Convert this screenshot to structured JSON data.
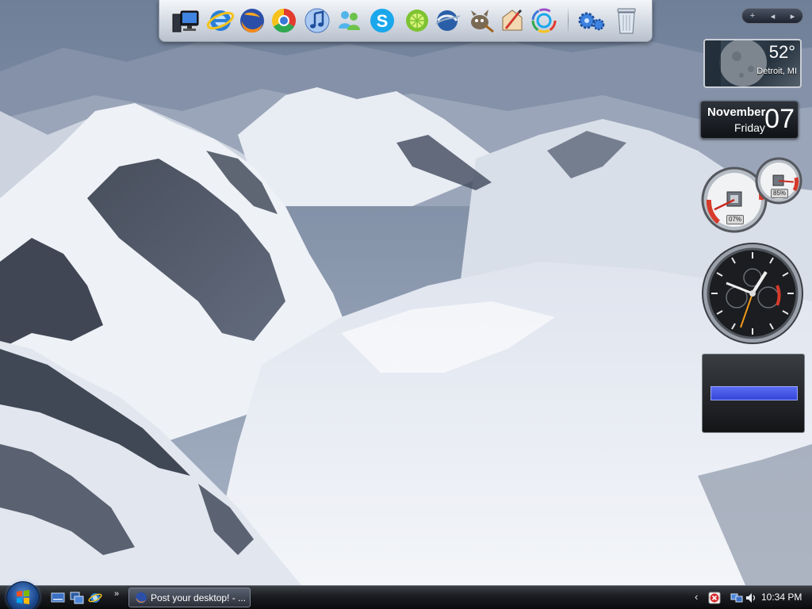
{
  "dock": {
    "icons": [
      {
        "name": "computer-icon"
      },
      {
        "name": "internet-explorer-icon"
      },
      {
        "name": "firefox-icon"
      },
      {
        "name": "chrome-icon"
      },
      {
        "name": "itunes-icon"
      },
      {
        "name": "messenger-icon"
      },
      {
        "name": "skype-icon"
      },
      {
        "name": "limewire-icon"
      },
      {
        "name": "google-earth-icon"
      },
      {
        "name": "gimp-icon"
      },
      {
        "name": "paint-icon"
      },
      {
        "name": "picasa-icon"
      },
      {
        "name": "settings-gears-icon"
      },
      {
        "name": "recycle-bin-icon"
      }
    ]
  },
  "sidebar_controls": {
    "add_label": "+",
    "prev_label": "◂",
    "next_label": "▸"
  },
  "weather": {
    "temperature": "52°",
    "location": "Detroit, MI"
  },
  "date_gadget": {
    "month": "November",
    "weekday": "Friday",
    "day": "07"
  },
  "cpu_meter": {
    "cpu_percent": "07%",
    "memory_percent": "85%",
    "cpu_value": 7,
    "memory_value": 85
  },
  "colors": {
    "taskbar": "#1a1c20",
    "media_bar": "#3446d8",
    "gauge_red": "#d63a2a"
  },
  "taskbar": {
    "task_button_label": "Post your desktop! - ...",
    "quick_launch_more": "»",
    "tray_chevron": "‹",
    "clock": "10:34 PM"
  }
}
